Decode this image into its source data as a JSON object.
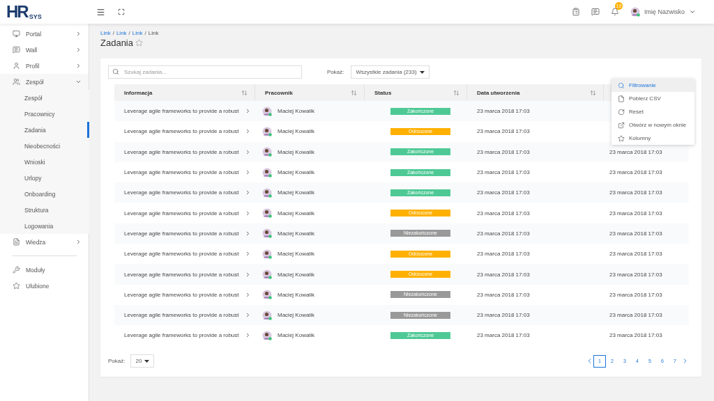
{
  "logo": {
    "main": "HR",
    "sub": "SYS"
  },
  "topbar": {
    "notifications": "10",
    "user": "Imię Nazwisko"
  },
  "sidebar": {
    "items": [
      {
        "label": "Portal",
        "expanded": false
      },
      {
        "label": "Wall",
        "expanded": false
      },
      {
        "label": "Profil",
        "expanded": false
      },
      {
        "label": "Zespół",
        "expanded": true,
        "children": [
          {
            "label": "Zespół",
            "selected": false
          },
          {
            "label": "Pracownicy",
            "selected": false
          },
          {
            "label": "Zadania",
            "selected": true
          },
          {
            "label": "Nieobecności",
            "selected": false
          },
          {
            "label": "Wnioski",
            "selected": false
          },
          {
            "label": "Urlopy",
            "selected": false
          },
          {
            "label": "Onboarding",
            "selected": false
          },
          {
            "label": "Struktura",
            "selected": false
          },
          {
            "label": "Logowania",
            "selected": false
          }
        ]
      },
      {
        "label": "Wiedza",
        "expanded": false
      }
    ],
    "bottom": [
      {
        "label": "Moduły"
      },
      {
        "label": "Ulubione"
      }
    ]
  },
  "breadcrumb": [
    {
      "label": "Link",
      "kind": "link"
    },
    {
      "label": "/",
      "kind": "separator"
    },
    {
      "label": "Link",
      "kind": "link"
    },
    {
      "label": "/",
      "kind": "separator"
    },
    {
      "label": "Link",
      "kind": "link"
    },
    {
      "label": "/",
      "kind": "separator"
    },
    {
      "label": "Link",
      "kind": "current"
    }
  ],
  "page_title": "Zadania",
  "toolbar": {
    "search_placeholder": "Szukaj zadania...",
    "show_label": "Pokaż:",
    "show_value": "Wszystkie zadania (233)"
  },
  "table": {
    "columns": [
      "Informacja",
      "Pracownik",
      "Status",
      "Data utworzenia"
    ],
    "rows": [
      {
        "info": "Leverage agile frameworks to provide a robust",
        "employee": "Maciej Kowalik",
        "status": "Zakończone",
        "color": "#4ec995",
        "date": "23 marca 2018 17:03"
      },
      {
        "info": "Leverage agile frameworks to provide a robust",
        "employee": "Maciej Kowalik",
        "status": "Odrzucone",
        "color": "#ffb000",
        "date": "23 marca 2018 17:03"
      },
      {
        "info": "Leverage agile frameworks to provide a robust",
        "employee": "Maciej Kowalik",
        "status": "Zakończone",
        "color": "#4ec995",
        "date": "23 marca 2018 17:03",
        "column_5": "23 marca 2018 17:03"
      },
      {
        "info": "Leverage agile frameworks to provide a robust",
        "employee": "Maciej Kowalik",
        "status": "Zakończone",
        "color": "#4ec995",
        "date": "23 marca 2018 17:03",
        "column_5": "23 marca 2018 17:03"
      },
      {
        "info": "Leverage agile frameworks to provide a robust",
        "employee": "Maciej Kowalik",
        "status": "Zakończone",
        "color": "#4ec995",
        "date": "23 marca 2018 17:03",
        "column_5": "23 marca 2018 17:03"
      },
      {
        "info": "Leverage agile frameworks to provide a robust",
        "employee": "Maciej Kowalik",
        "status": "Odrzucone",
        "color": "#ffb000",
        "date": "23 marca 2018 17:03",
        "column_5": "23 marca 2018 17:03"
      },
      {
        "info": "Leverage agile frameworks to provide a robust",
        "employee": "Maciej Kowalik",
        "status": "Niezakończone",
        "color": "#999999",
        "date": "23 marca 2018 17:03",
        "column_5": "23 marca 2018 17:03"
      },
      {
        "info": "Leverage agile frameworks to provide a robust",
        "employee": "Maciej Kowalik",
        "status": "Odrzucone",
        "color": "#ffb000",
        "date": "23 marca 2018 17:03",
        "column_5": "23 marca 2018 17:03"
      },
      {
        "info": "Leverage agile frameworks to provide a robust",
        "employee": "Maciej Kowalik",
        "status": "Odrzucone",
        "color": "#ffb000",
        "date": "23 marca 2018 17:03",
        "column_5": "23 marca 2018 17:03"
      },
      {
        "info": "Leverage agile frameworks to provide a robust",
        "employee": "Maciej Kowalik",
        "status": "Niezakończone",
        "color": "#999999",
        "date": "23 marca 2018 17:03",
        "column_5": "23 marca 2018 17:03"
      },
      {
        "info": "Leverage agile frameworks to provide a robust",
        "employee": "Maciej Kowalik",
        "status": "Niezakończone",
        "color": "#999999",
        "date": "23 marca 2018 17:03",
        "column_5": "23 marca 2018 17:03"
      },
      {
        "info": "Leverage agile frameworks to provide a robust",
        "employee": "Maciej Kowalik",
        "status": "Zakończone",
        "color": "#4ec995",
        "date": "23 marca 2018 17:03",
        "column_5": "23 marca 2018 17:03"
      }
    ]
  },
  "menu": [
    {
      "label": "Filtrowanie",
      "selected": true
    },
    {
      "label": "Pobierz CSV",
      "selected": false
    },
    {
      "label": "Reset",
      "selected": false
    },
    {
      "label": "Otwórz w nowym oknie",
      "selected": false
    },
    {
      "label": "Kolumny",
      "selected": false
    }
  ],
  "footer": {
    "show_label": "Pokaż:",
    "page_size": "20",
    "pages": [
      {
        "label": "1",
        "selected": true
      },
      {
        "label": "2",
        "selected": false
      },
      {
        "label": "3",
        "selected": false
      },
      {
        "label": "4",
        "selected": false
      },
      {
        "label": "5",
        "selected": false
      },
      {
        "label": "6",
        "selected": false
      },
      {
        "label": "7",
        "selected": false
      }
    ]
  }
}
